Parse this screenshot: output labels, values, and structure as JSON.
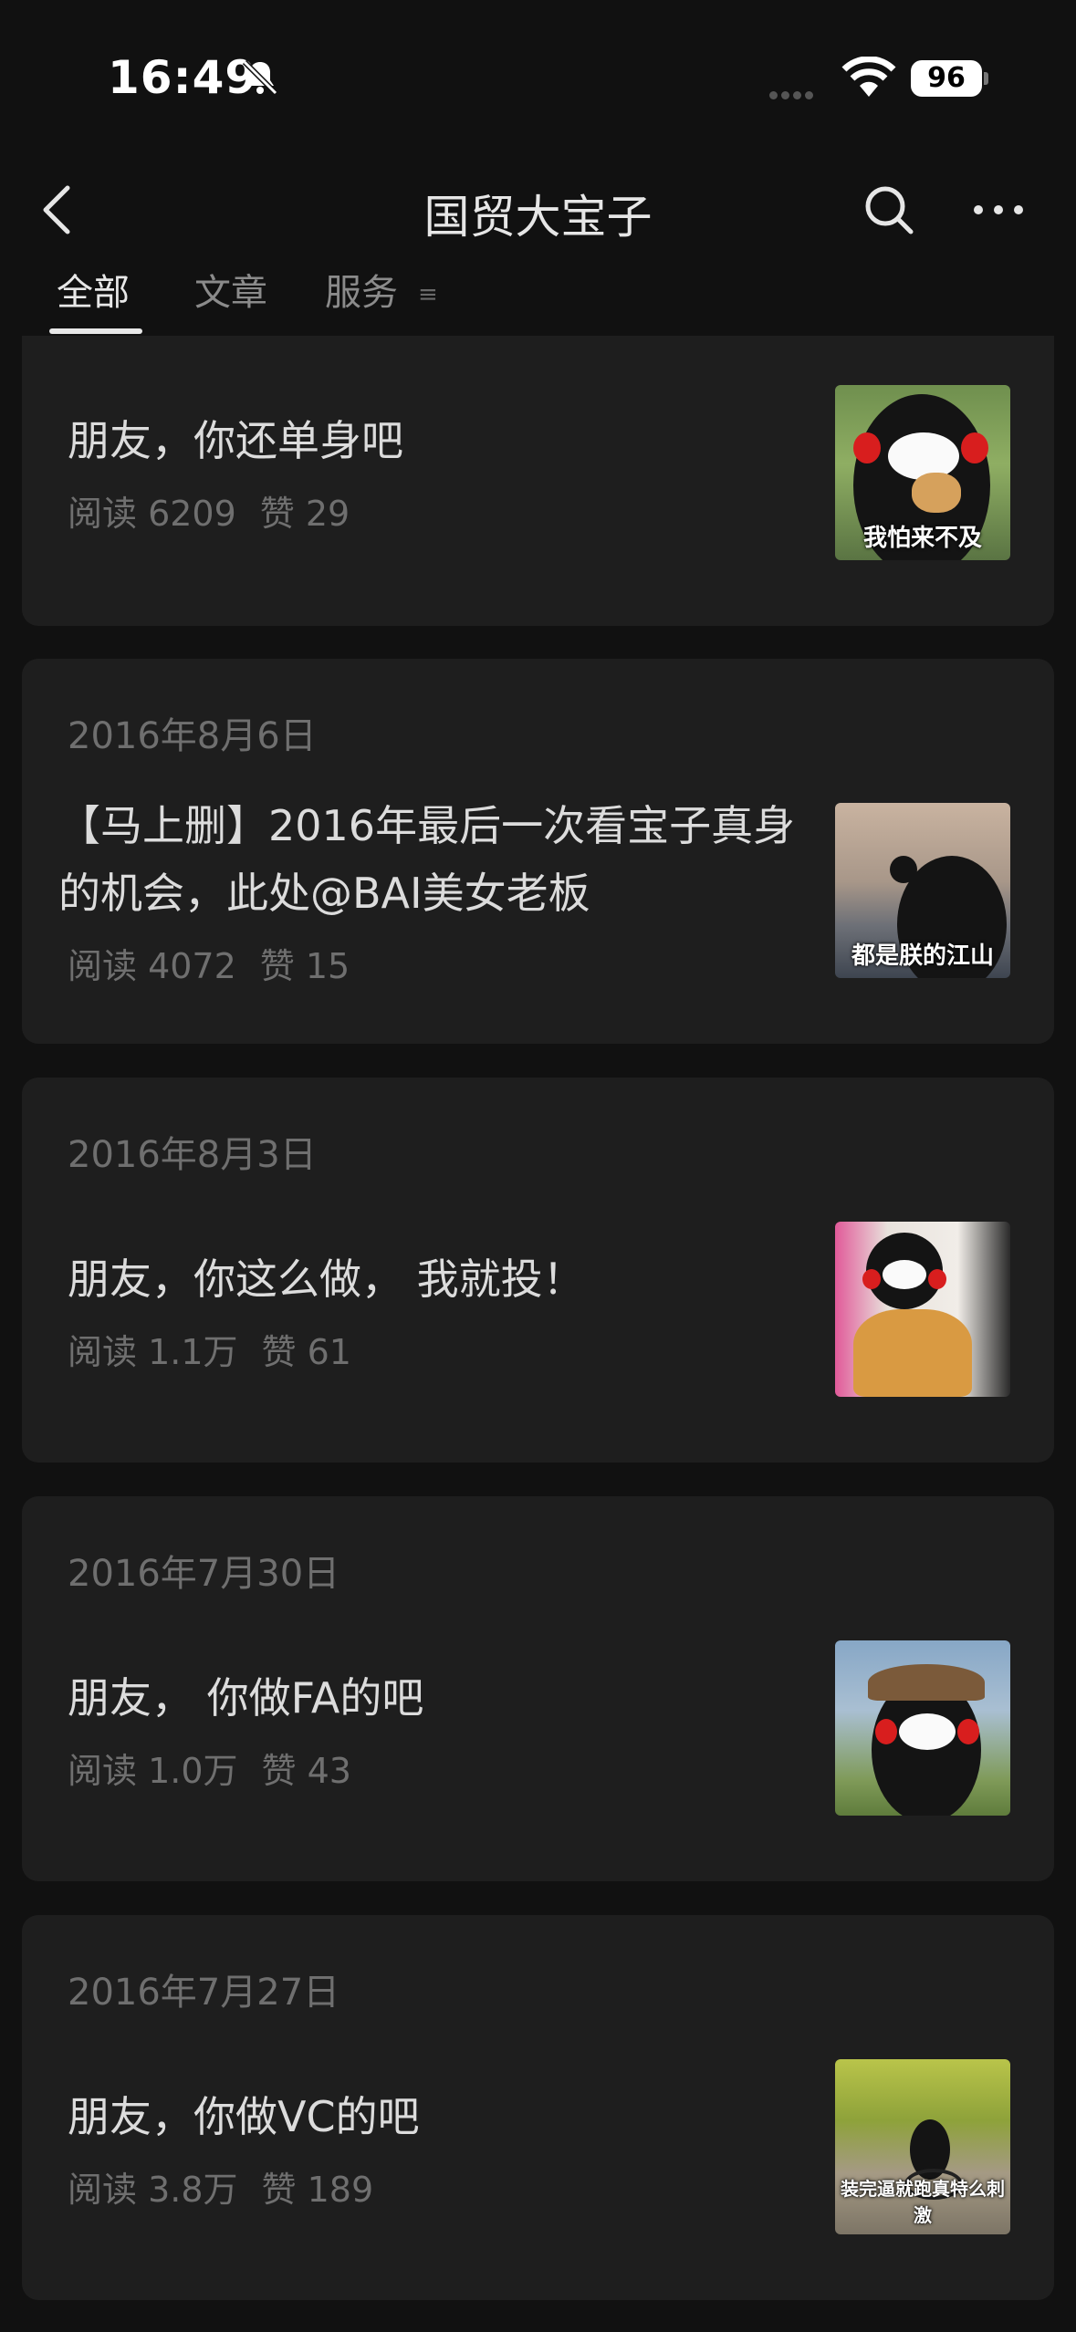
{
  "status": {
    "time": "16:49",
    "battery": "96"
  },
  "nav": {
    "title": "国贸大宝子"
  },
  "tabs": [
    {
      "label": "全部"
    },
    {
      "label": "文章"
    },
    {
      "label": "服务"
    }
  ],
  "tab_menu_glyph": "≡",
  "articles": [
    {
      "date": "",
      "title": "朋友，你还单身吧",
      "reads": "阅读 6209",
      "likes": "赞 29",
      "thumb_caption": "我怕来不及"
    },
    {
      "date": "2016年8月6日",
      "title": "【马上删】2016年最后一次看宝子真身的机会，此处@BAI美女老板",
      "reads": "阅读 4072",
      "likes": "赞 15",
      "thumb_caption": "都是朕的江山"
    },
    {
      "date": "2016年8月3日",
      "title": "朋友，你这么做， 我就投！",
      "reads": "阅读 1.1万",
      "likes": "赞 61",
      "thumb_caption": ""
    },
    {
      "date": "2016年7月30日",
      "title": "朋友， 你做FA的吧",
      "reads": "阅读 1.0万",
      "likes": "赞 43",
      "thumb_caption": ""
    },
    {
      "date": "2016年7月27日",
      "title": "朋友，你做VC的吧",
      "reads": "阅读 3.8万",
      "likes": "赞 189",
      "thumb_caption": "装完逼就跑真特么刺激"
    }
  ],
  "colors": {
    "background": "#111111",
    "card": "#1e1e1e",
    "accent_red": "#d81e1e"
  }
}
